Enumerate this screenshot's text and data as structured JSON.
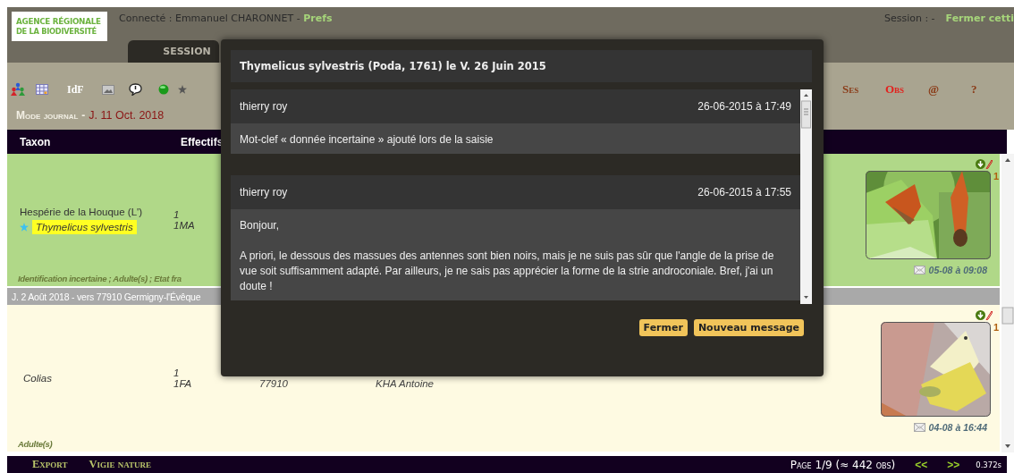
{
  "header": {
    "logo_lines": [
      "AGENCE RÉGIONALE",
      "DE LA BIODIVERSITÉ"
    ],
    "connected_label": "Connecté : Emmanuel CHARONNET - ",
    "prefs_link": "Prefs",
    "session_label": "Session : -",
    "close_link": "Fermer cetti",
    "tabs": [
      {
        "label": "SESSION",
        "selected": true
      }
    ]
  },
  "toolbar": {
    "region_label": "IdF",
    "mode_label": "Mode journal",
    "mode_separator": "-",
    "mode_date": "J. 11 Oct. 2018",
    "menu": [
      {
        "label": "Ses",
        "selected": false
      },
      {
        "label": "Obs",
        "selected": true
      },
      {
        "label": "@",
        "selected": false
      },
      {
        "label": "?",
        "selected": false
      }
    ]
  },
  "table": {
    "columns": [
      "Taxon",
      "Effectifs"
    ],
    "rows": [
      {
        "kind": "observation",
        "color": "#b0d888",
        "common_name": "Hespérie de la Houque (L')",
        "scientific_name": "Thymelicus sylvestris",
        "starred": true,
        "highlighted": true,
        "counts": [
          "1",
          "1MA"
        ],
        "remarks": "Identification incertaine ; Adulte(s) ; Etat fra",
        "photo_count": "1",
        "date": "05-08 à 09:08"
      },
      {
        "kind": "group",
        "label": "J. 2 Août 2018 - vers 77910 Germigny-l'Évêque"
      },
      {
        "kind": "observation",
        "color": "#fefae2",
        "scientific_name": "Colias",
        "starred": false,
        "highlighted": false,
        "counts": [
          "1",
          "1FA"
        ],
        "commune": "77910",
        "observer": "KHA Antoine",
        "remarks": "Adulte(s)",
        "photo_count": "1",
        "date": "04-08 à 16:44"
      }
    ]
  },
  "footer": {
    "links": [
      "Export",
      "Vigie nature"
    ],
    "page_info": "Page 1/9 (≈ 442 obs)",
    "prev": "<<",
    "next": ">>",
    "timing": "0.372s"
  },
  "dialog": {
    "title": "Thymelicus sylvestris (Poda, 1761) le V. 26 Juin 2015",
    "messages": [
      {
        "author": "thierry roy",
        "time": "26-06-2015 à 17:49",
        "paragraphs": [
          "Mot-clef « donnée incertaine » ajouté lors de la saisie"
        ]
      },
      {
        "author": "thierry roy",
        "time": "26-06-2015 à 17:55",
        "paragraphs": [
          "Bonjour,",
          "A priori, le dessous des massues des antennes sont bien noirs, mais je ne suis pas sûr que l'angle de la prise de vue soit suffisamment adapté. Par ailleurs, je ne sais pas apprécier la forme de la strie androconiale. Bref, j'ai un doute !"
        ]
      }
    ],
    "buttons": [
      "Fermer",
      "Nouveau message"
    ]
  }
}
